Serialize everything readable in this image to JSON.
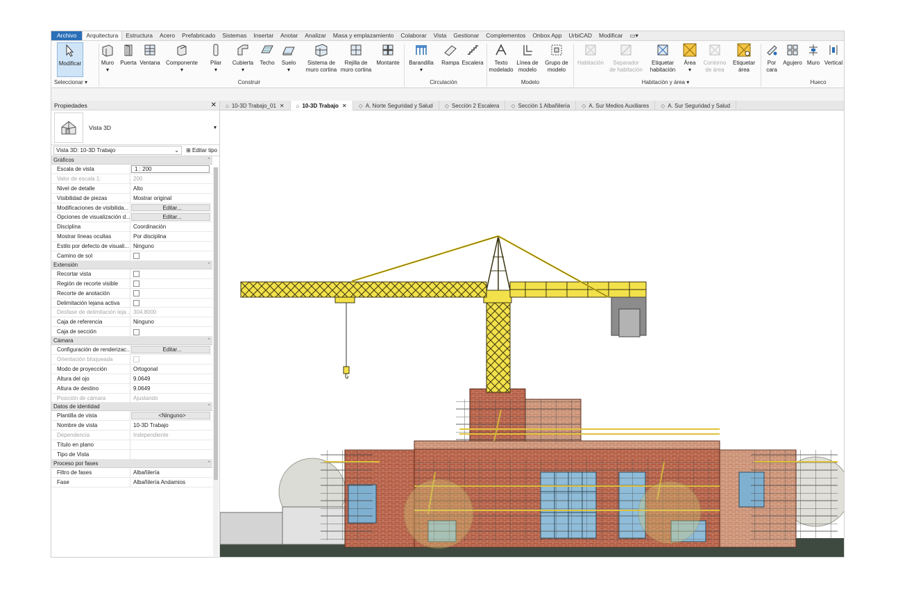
{
  "menu": {
    "tabs": [
      "Archivo",
      "Arquitectura",
      "Estructura",
      "Acero",
      "Prefabricado",
      "Sistemas",
      "Insertar",
      "Anotar",
      "Analizar",
      "Masa y emplazamiento",
      "Colaborar",
      "Vista",
      "Gestionar",
      "Complementos",
      "Onbox App",
      "UrbiCAD",
      "Modificar"
    ],
    "active": "Arquitectura"
  },
  "ribbon": {
    "select": {
      "modify": "Modificar",
      "panel": "Seleccionar ▾"
    },
    "build": {
      "panel": "Construir",
      "buttons": [
        "Muro",
        "Puerta",
        "Ventana",
        "Componente",
        "Pilar",
        "Cubierta",
        "Techo",
        "Suelo"
      ],
      "curtain_system_1": "Sistema de",
      "curtain_system_2": "muro cortina",
      "curtain_grid_1": "Rejilla de",
      "curtain_grid_2": "muro cortina",
      "mullion": "Montante"
    },
    "circulation": {
      "panel": "Circulación",
      "buttons": [
        "Barandilla",
        "Rampa",
        "Escalera"
      ]
    },
    "model": {
      "panel": "Modelo",
      "text_1": "Texto",
      "text_2": "modelado",
      "line_1": "Línea de",
      "line_2": "modelo",
      "group_1": "Grupo de",
      "group_2": "modelo"
    },
    "room": {
      "panel": "Habitación y área ▾",
      "room": "Habitación",
      "sep_1": "Separador",
      "sep_2": "de habitación",
      "tag_room_1": "Etiquetar",
      "tag_room_2": "habitación",
      "area": "Área",
      "area_b_1": "Contorno",
      "area_b_2": "de área",
      "tag_area_1": "Etiquetar",
      "tag_area_2": "área"
    },
    "opening": {
      "panel": "Hueco",
      "by_face_1": "Por",
      "by_face_2": "cara",
      "buttons": [
        "Agujero",
        "Muro",
        "Vertical"
      ]
    }
  },
  "properties": {
    "title": "Propiedades",
    "type_name": "Vista 3D",
    "selector": "Vista 3D: 10-3D Trabajo",
    "edit_type": "Editar tipo",
    "groups": [
      {
        "name": "Gráficos",
        "rows": [
          [
            "Escala de vista",
            "1 : 200",
            "box"
          ],
          [
            "Valor de escala    1:",
            "200",
            "dim"
          ],
          [
            "Nivel de detalle",
            "Alto",
            ""
          ],
          [
            "Visibilidad de piezas",
            "Mostrar original",
            ""
          ],
          [
            "Modificaciones de visibilida...",
            "Editar...",
            "btn"
          ],
          [
            "Opciones de visualización d...",
            "Editar...",
            "btn"
          ],
          [
            "Disciplina",
            "Coordinación",
            ""
          ],
          [
            "Mostrar líneas ocultas",
            "Por disciplina",
            ""
          ],
          [
            "Estilo por defecto de visuali...",
            "Ninguno",
            ""
          ],
          [
            "Camino de sol",
            "",
            "check"
          ]
        ]
      },
      {
        "name": "Extensión",
        "rows": [
          [
            "Recortar vista",
            "",
            "check"
          ],
          [
            "Región de recorte visible",
            "",
            "check"
          ],
          [
            "Recorte de anotación",
            "",
            "check"
          ],
          [
            "Delimitación lejana activa",
            "",
            "check"
          ],
          [
            "Desfase de delimitación leja...",
            "304.8000",
            "dim"
          ],
          [
            "Caja de referencia",
            "Ninguno",
            ""
          ],
          [
            "Caja de sección",
            "",
            "check"
          ]
        ]
      },
      {
        "name": "Cámara",
        "rows": [
          [
            "Configuración de renderizac...",
            "Editar...",
            "btn"
          ],
          [
            "Orientación bloqueada",
            "",
            "dimcheck"
          ],
          [
            "Modo de proyección",
            "Ortogonal",
            ""
          ],
          [
            "Altura del ojo",
            "9.0649",
            ""
          ],
          [
            "Altura de destino",
            "9.0649",
            ""
          ],
          [
            "Posición de cámara",
            "Ajustando",
            "dim"
          ]
        ]
      },
      {
        "name": "Datos de identidad",
        "rows": [
          [
            "Plantilla de vista",
            "<Ninguno>",
            "btn"
          ],
          [
            "Nombre de vista",
            "10-3D Trabajo",
            ""
          ],
          [
            "Dependencia",
            "Independiente",
            "dim"
          ],
          [
            "Título en plano",
            "",
            ""
          ],
          [
            "Tipo de Vista",
            "",
            ""
          ]
        ]
      },
      {
        "name": "Proceso por fases",
        "rows": [
          [
            "Filtro de fases",
            "Albañilería",
            ""
          ],
          [
            "Fase",
            "Albañilería Andamios",
            ""
          ]
        ]
      }
    ]
  },
  "view_tabs": [
    {
      "label": "10-3D Trabajo_01",
      "active": false
    },
    {
      "label": "10-3D Trabajo",
      "active": true
    },
    {
      "label": "A. Norte Seguridad y Salud",
      "active": false
    },
    {
      "label": "Sección 2 Escalera",
      "active": false
    },
    {
      "label": "Sección 1 Albañilería",
      "active": false
    },
    {
      "label": "A. Sur Medios Auxiliares",
      "active": false
    },
    {
      "label": "A. Sur Seguridad y Salud",
      "active": false
    }
  ],
  "colors": {
    "accent": "#2a6fb8",
    "crane": "#f2e14a",
    "brick": "#b8604a",
    "glass": "#7fb0d0"
  }
}
